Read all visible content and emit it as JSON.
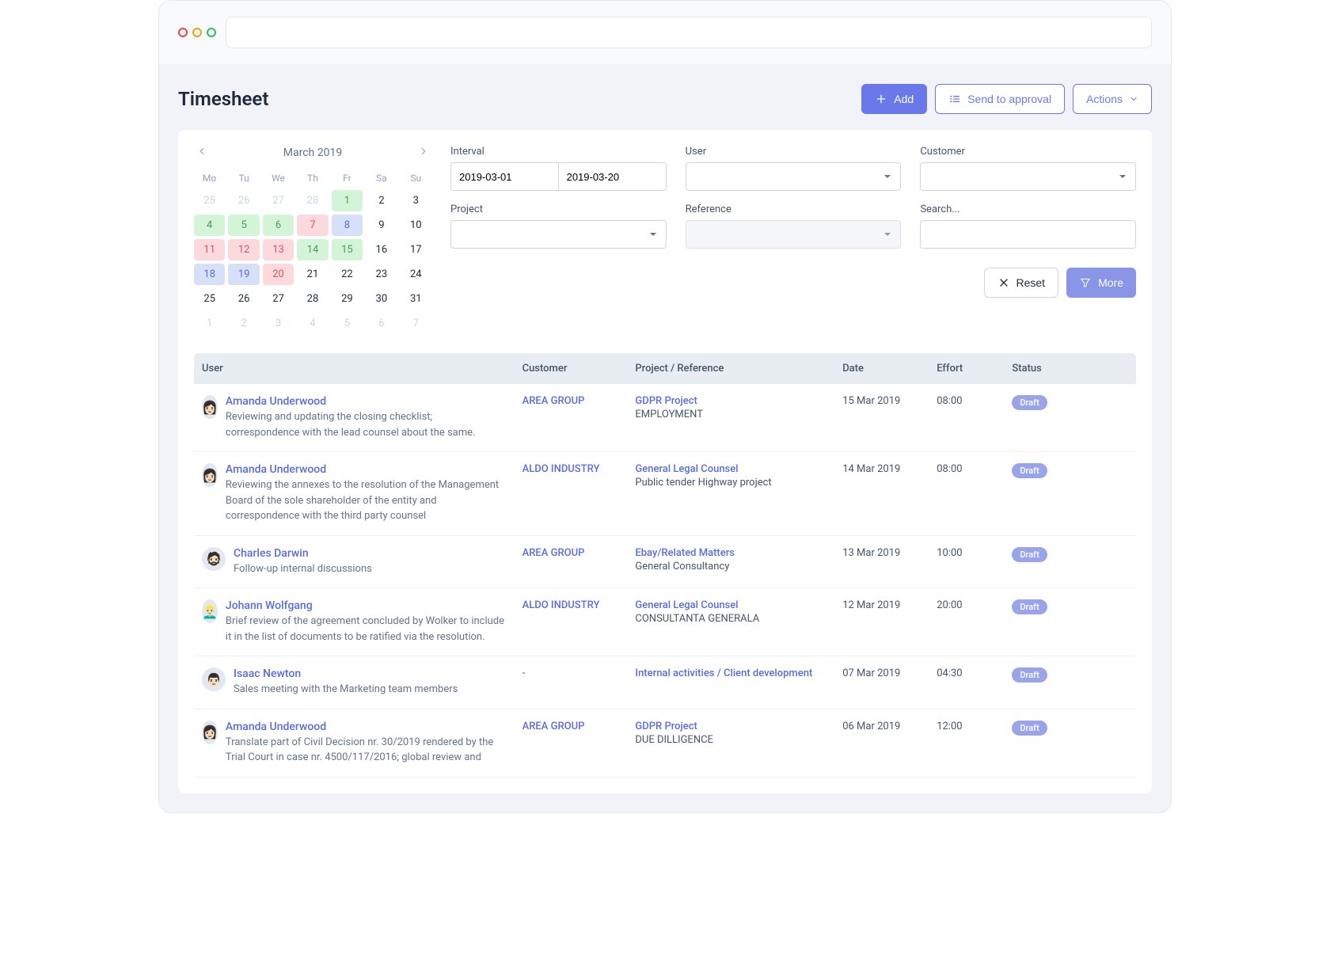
{
  "page_title": "Timesheet",
  "header_buttons": {
    "add": "Add",
    "send_approval": "Send to approval",
    "actions": "Actions"
  },
  "calendar": {
    "month": "March 2019",
    "dow": [
      "Mo",
      "Tu",
      "We",
      "Th",
      "Fr",
      "Sa",
      "Su"
    ],
    "weeks": [
      [
        {
          "n": "25",
          "c": "muted"
        },
        {
          "n": "26",
          "c": "muted"
        },
        {
          "n": "27",
          "c": "muted"
        },
        {
          "n": "28",
          "c": "muted"
        },
        {
          "n": "1",
          "c": "green"
        },
        {
          "n": "2",
          "c": ""
        },
        {
          "n": "3",
          "c": ""
        }
      ],
      [
        {
          "n": "4",
          "c": "green"
        },
        {
          "n": "5",
          "c": "green"
        },
        {
          "n": "6",
          "c": "green"
        },
        {
          "n": "7",
          "c": "red"
        },
        {
          "n": "8",
          "c": "blue"
        },
        {
          "n": "9",
          "c": ""
        },
        {
          "n": "10",
          "c": ""
        }
      ],
      [
        {
          "n": "11",
          "c": "red"
        },
        {
          "n": "12",
          "c": "red"
        },
        {
          "n": "13",
          "c": "red"
        },
        {
          "n": "14",
          "c": "green"
        },
        {
          "n": "15",
          "c": "green"
        },
        {
          "n": "16",
          "c": ""
        },
        {
          "n": "17",
          "c": ""
        }
      ],
      [
        {
          "n": "18",
          "c": "blue"
        },
        {
          "n": "19",
          "c": "blue"
        },
        {
          "n": "20",
          "c": "red"
        },
        {
          "n": "21",
          "c": ""
        },
        {
          "n": "22",
          "c": ""
        },
        {
          "n": "23",
          "c": ""
        },
        {
          "n": "24",
          "c": ""
        }
      ],
      [
        {
          "n": "25",
          "c": ""
        },
        {
          "n": "26",
          "c": ""
        },
        {
          "n": "27",
          "c": ""
        },
        {
          "n": "28",
          "c": ""
        },
        {
          "n": "29",
          "c": ""
        },
        {
          "n": "30",
          "c": ""
        },
        {
          "n": "31",
          "c": ""
        }
      ],
      [
        {
          "n": "1",
          "c": "muted"
        },
        {
          "n": "2",
          "c": "muted"
        },
        {
          "n": "3",
          "c": "muted"
        },
        {
          "n": "4",
          "c": "muted"
        },
        {
          "n": "5",
          "c": "muted"
        },
        {
          "n": "6",
          "c": "muted"
        },
        {
          "n": "7",
          "c": "muted"
        }
      ]
    ]
  },
  "filters": {
    "interval_label": "Interval",
    "interval_from": "2019-03-01",
    "interval_to": "2019-03-20",
    "user_label": "User",
    "customer_label": "Customer",
    "project_label": "Project",
    "reference_label": "Reference",
    "search_label": "Search...",
    "reset": "Reset",
    "more": "More"
  },
  "columns": [
    "User",
    "Customer",
    "Project / Reference",
    "Date",
    "Effort",
    "Status"
  ],
  "rows": [
    {
      "user": "Amanda Underwood",
      "avatar": "👩🏻",
      "desc": "Reviewing and updating the closing checklist; correspondence with the lead counsel about the same.",
      "customer": "AREA GROUP",
      "project": "GDPR Project",
      "reference": "EMPLOYMENT",
      "date": "15 Mar 2019",
      "effort": "08:00",
      "status": "Draft"
    },
    {
      "user": "Amanda Underwood",
      "avatar": "👩🏻",
      "desc": "Reviewing the annexes to the resolution of the Management Board of the sole shareholder of the entity and correspondence with the third party counsel",
      "customer": "ALDO INDUSTRY",
      "project": "General Legal Counsel",
      "reference": "Public tender Highway project",
      "date": "14 Mar 2019",
      "effort": "08:00",
      "status": "Draft"
    },
    {
      "user": "Charles Darwin",
      "avatar": "🧔🏻",
      "desc": "Follow-up internal discussions",
      "customer": "AREA GROUP",
      "project": "Ebay/Related Matters",
      "reference": "General Consultancy",
      "date": "13 Mar 2019",
      "effort": "10:00",
      "status": "Draft"
    },
    {
      "user": "Johann Wolfgang",
      "avatar": "👱🏻‍♂️",
      "desc": "Brief review of the agreement concluded by Wolker to include it in the list of documents to be ratified via the resolution.",
      "customer": "ALDO INDUSTRY",
      "project": "General Legal Counsel",
      "reference": "CONSULTANTA GENERALA",
      "date": "12 Mar 2019",
      "effort": "20:00",
      "status": "Draft"
    },
    {
      "user": "Isaac Newton",
      "avatar": "👨🏻",
      "desc": "Sales meeting with the Marketing team members",
      "customer": "-",
      "project": "Internal activities / Client development",
      "reference": "",
      "date": "07 Mar 2019",
      "effort": "04:30",
      "status": "Draft"
    },
    {
      "user": "Amanda Underwood",
      "avatar": "👩🏻",
      "desc": "Translate part of Civil Decision nr. 30/2019 rendered by the Trial Court in case nr. 4500/117/2016; global review and",
      "customer": "AREA GROUP",
      "project": "GDPR Project",
      "reference": "DUE DILLIGENCE",
      "date": "06 Mar 2019",
      "effort": "12:00",
      "status": "Draft"
    }
  ]
}
